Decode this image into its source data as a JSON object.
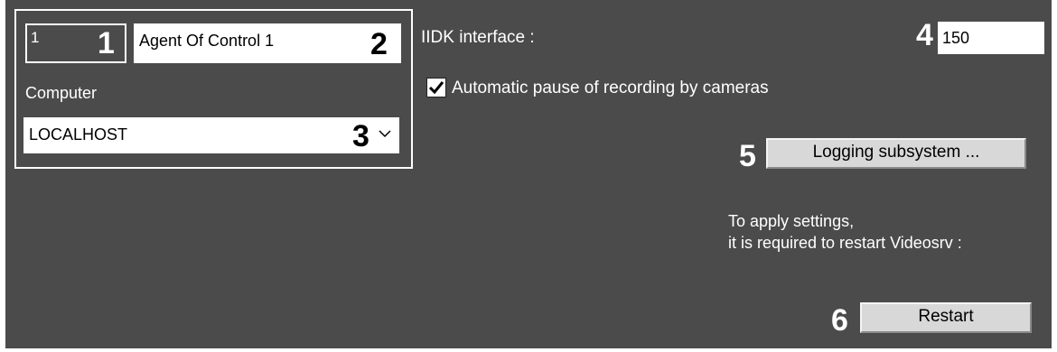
{
  "object": {
    "id_value": "1",
    "name_value": "Agent Of Control 1",
    "computer_label": "Computer",
    "computer_value": "LOCALHOST"
  },
  "iidk": {
    "label": "IIDK interface :",
    "value": "150"
  },
  "auto_pause": {
    "label": "Automatic pause of recording by cameras",
    "checked": true
  },
  "logging_button": "Logging subsystem ...",
  "restart_note": {
    "line1": "To apply settings,",
    "line2": "it is required to restart Videosrv :"
  },
  "restart_button": "Restart",
  "callouts": [
    "1",
    "2",
    "3",
    "4",
    "5",
    "6"
  ]
}
